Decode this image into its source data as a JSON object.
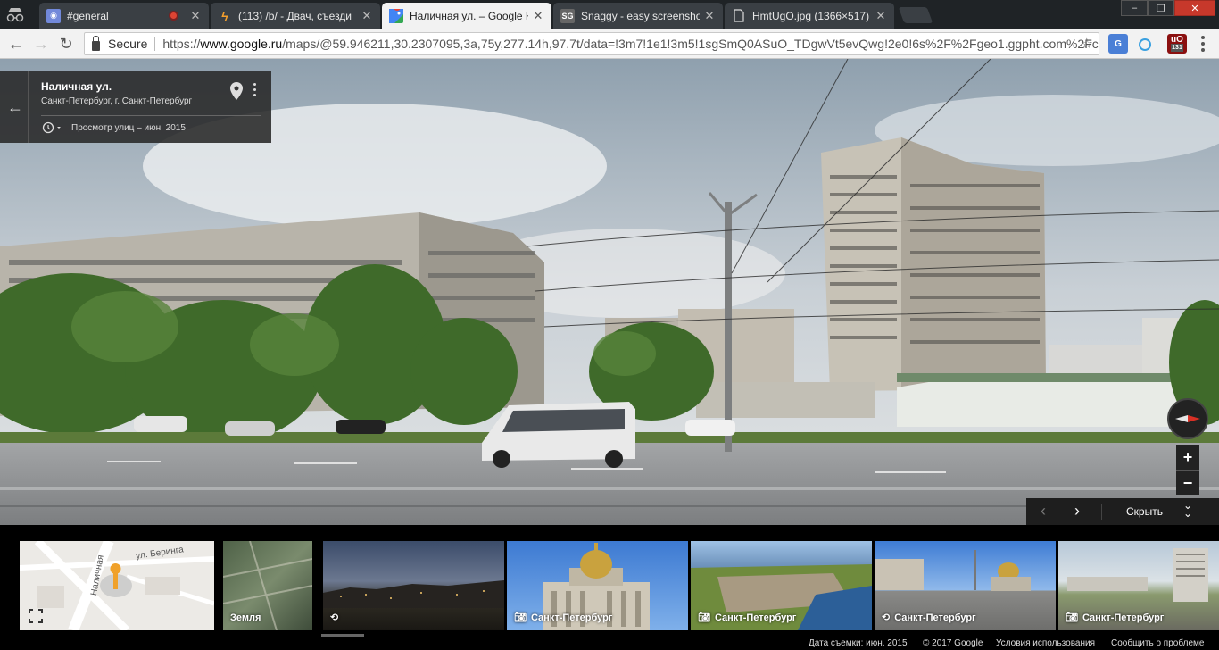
{
  "browser": {
    "tabs": [
      {
        "title": "#general",
        "icon": "discord-icon"
      },
      {
        "title": "(113) /b/ - Двач, съезди",
        "icon": "dvach-icon"
      },
      {
        "title": "Наличная ул. – Google К",
        "icon": "google-maps-icon",
        "active": true
      },
      {
        "title": "Snaggy - easy screensho",
        "icon": "snaggy-icon",
        "icon_text": "SG"
      },
      {
        "title": "HmtUgO.jpg (1366×517)",
        "icon": "document-icon"
      }
    ],
    "security_label": "Secure",
    "url_scheme": "https://",
    "url_host": "www.google.ru",
    "url_path": "/maps/@59.946211,30.2307095,3a,75y,277.14h,97.7t/data=!3m7!1e1!3m5!1sgSmQ0ASuO_TDgwVt5evQwg!2e0!6s%2F%2Fgeo1.ggpht.com%2Fc",
    "extension_badge": "131"
  },
  "infocard": {
    "street": "Наличная ул.",
    "city": "Санкт-Петербург, г. Санкт-Петербург",
    "history": "Просмотр улиц – июн. 2015"
  },
  "controls": {
    "zoom_in": "+",
    "zoom_out": "−",
    "hide_label": "Скрыть"
  },
  "thumbnails": [
    {
      "caption": "",
      "type": "map",
      "map_label_1": "ул. Беринга",
      "map_label_2": "Наличная"
    },
    {
      "caption": "Земля",
      "type": "satellite"
    },
    {
      "caption": "",
      "type": "photosphere"
    },
    {
      "caption": "Санкт-Петербург",
      "type": "photo"
    },
    {
      "caption": "Санкт-Петербург",
      "type": "photo"
    },
    {
      "caption": "Санкт-Петербург",
      "type": "photosphere"
    },
    {
      "caption": "Санкт-Петербург",
      "type": "photo"
    }
  ],
  "footer": {
    "date": "Дата съемки: июн. 2015",
    "copyright": "© 2017 Google",
    "terms": "Условия использования",
    "report": "Сообщить о проблеме"
  },
  "colors": {
    "sky": "#c9d0d6",
    "road": "#8f9193",
    "grass": "#5c7a3a",
    "tree": "#3f6a2a",
    "panel": "#2a2a2a",
    "compass_red": "#d93025"
  }
}
